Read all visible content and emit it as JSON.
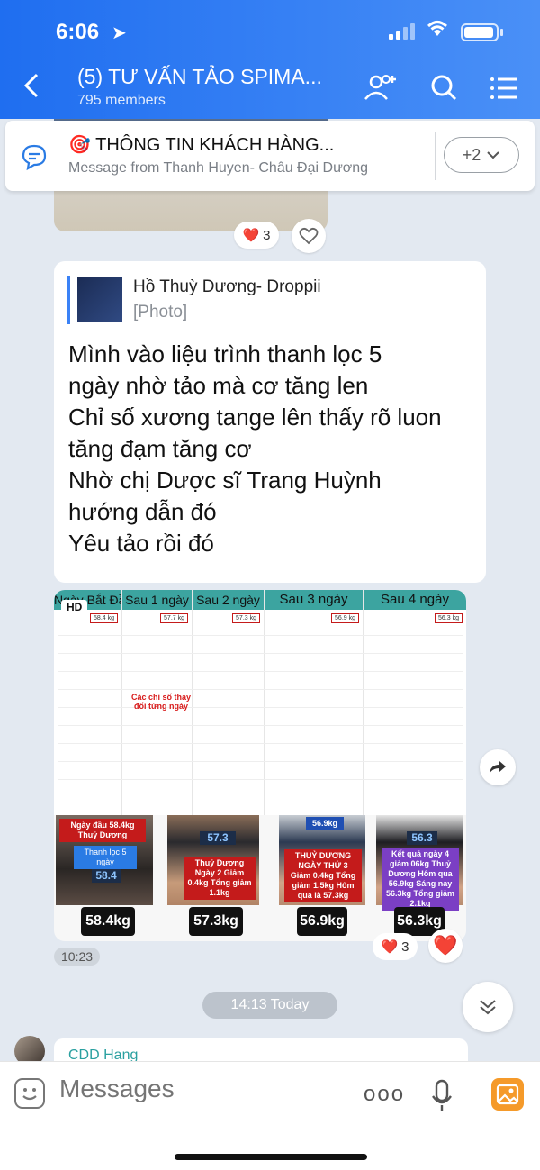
{
  "status": {
    "time": "6:06"
  },
  "header": {
    "title": "(5) TƯ VẤN TẢO SPIMA...",
    "members": "795 members"
  },
  "pinned": {
    "title": "🎯 THÔNG TIN KHÁCH HÀNG...",
    "subtitle": "Message from Thanh Huyen- Châu Đại Dương",
    "more": "+2"
  },
  "top_reaction": {
    "count": "3"
  },
  "message": {
    "quote_name": "Hồ Thuỳ Dương- Droppii",
    "quote_type": "[Photo]",
    "lines": [
      "Mình vào liệu trình thanh lọc 5",
      "ngày nhờ tảo mà cơ tăng len",
      "Chỉ số xương tange lên thấy rõ luon",
      "tăng đạm tăng cơ",
      "Nhờ chị Dược sĩ Trang Huỳnh",
      "hướng dẫn đó",
      "Yêu tảo rồi đó"
    ]
  },
  "collage": {
    "hd": "HD",
    "panels": [
      "Ngày Bắt Đầu",
      "Sau 1 ngày",
      "Sau 2 ngày",
      "Sau 3 ngày",
      "Sau 4 ngày"
    ],
    "weights": [
      "58.4 kg",
      "57.7 kg",
      "57.3 kg",
      "56.9 kg",
      "56.3 kg"
    ],
    "note": "Các chỉ số thay đổi từng ngày",
    "scale_notes": [
      "Ngày đầu 58.4kg Thuỷ Dương",
      "Thanh lọc 5 ngày",
      "Thuỷ Dương Ngày 2 Giảm 0.4kg Tổng giảm 1.1kg",
      "THUỶ DƯƠNG NGÀY THỨ 3 Giảm 0.4kg Tổng giảm 1.5kg Hôm qua là 57.3kg",
      "Kết quả ngày 4 giảm 06kg Thuỷ Dương Hôm qua 56.9kg Sáng nay 56.3kg Tổng giảm 2.1kg"
    ],
    "scale_readings": [
      "58.4",
      "57.3",
      "56.9kg",
      "56.3"
    ],
    "tags": [
      "58.4kg",
      "57.3kg",
      "56.9kg",
      "56.3kg"
    ]
  },
  "collage_reaction": {
    "count": "3"
  },
  "message_time": "10:23",
  "date_separator": "14:13 Today",
  "next_message": {
    "sender": "CDD Hang"
  },
  "input": {
    "placeholder": "Messages",
    "more": "ooo"
  },
  "colors": {
    "accent": "#1f6ef0",
    "heart": "#e0245e",
    "tag_red": "#c41b1b"
  }
}
